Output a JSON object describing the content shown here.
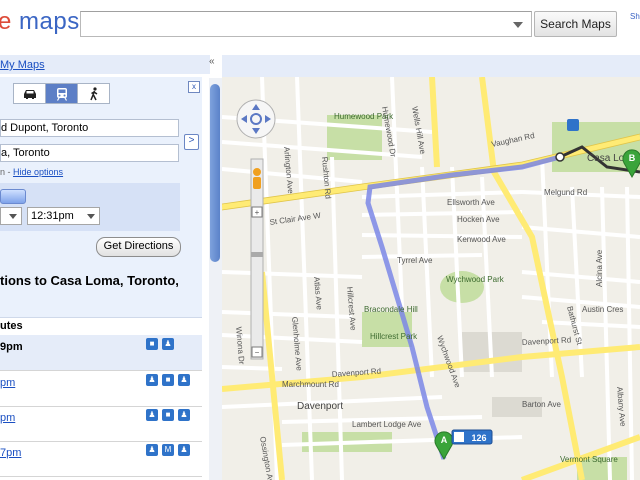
{
  "header": {
    "logo_partial": "e",
    "logo_maps": "maps",
    "search_button": "Search Maps",
    "top_link": "Sh"
  },
  "panel": {
    "my_maps": "My Maps",
    "collapse_glyph": "«",
    "modes": [
      {
        "name": "driving",
        "icon": "car-icon"
      },
      {
        "name": "transit",
        "icon": "train-icon",
        "active": true
      },
      {
        "name": "walking",
        "icon": "walk-icon"
      }
    ],
    "close_glyph": "x",
    "from_value": "d Dupont, Toronto",
    "to_value": "a, Toronto",
    "options_prefix": "n - ",
    "hide_options": "Hide options",
    "time_value": "12:31pm",
    "get_directions": "Get Directions",
    "heading": "tions to Casa Loma, Toronto,",
    "heading_line2": "",
    "routes_label": "utes",
    "routes": [
      {
        "time": "9pm",
        "icons": [
          "bus",
          "walk"
        ]
      },
      {
        "time": "pm",
        "icons": [
          "walk",
          "bus",
          "walk"
        ]
      },
      {
        "time": "pm",
        "icons": [
          "walk",
          "bus",
          "walk"
        ]
      },
      {
        "time": "7pm",
        "icons": [
          "walk",
          "M",
          "walk"
        ]
      }
    ]
  },
  "map": {
    "streets": {
      "st_clair": "St Clair Ave W",
      "davenport": "Davenport Rd",
      "davenport2": "Davenport Rd",
      "marchmount": "Marchmount Rd",
      "ellsworth": "Ellsworth Ave",
      "hocken": "Hocken Ave",
      "kenwood": "Kenwood Ave",
      "tyrrel": "Tyrrel Ave",
      "lambert": "Lambert Lodge Ave",
      "wychwood": "Wychwood Ave",
      "bathurst": "Bathurst St",
      "christie": "Christie St",
      "vaughan": "Vaughan Rd",
      "melgund": "Melgund Rd",
      "austin": "Austin Cres",
      "alcina": "Alcina Ave",
      "burnside": "Burnside Dr",
      "humewood_dr": "Humewood Dr",
      "rushton": "Rushton Rd",
      "arlington": "Arlington Ave",
      "winona": "Winona Dr",
      "atlas": "Atlas Ave",
      "glenholme": "Glenholme Ave",
      "ossington": "Ossington Ave",
      "hillcrest": "Hillcrest Ave",
      "verbena": "Verbena Ave",
      "benson": "Benson Ave",
      "helena": "Helena Ave",
      "ardwold": "Ardwold Gate",
      "wells_hill": "Wells Hill Ave",
      "bartlett": "Bartlett Ave",
      "wychwood_rd": "Wychwood Ave",
      "barton": "Barton Ave",
      "albany": "Albany Ave",
      "lippincott": "Lippincott St"
    },
    "places": {
      "humewood": "Humewood Park",
      "wychwood_park": "Wychwood Park",
      "bracondale": "Bracondale Hill",
      "hillcrest_park": "Hillcrest Park",
      "casa_loma": "Casa Loma",
      "davenport_area": "Davenport",
      "vermont": "Vermont Square"
    },
    "markers": {
      "a": "A",
      "b": "B",
      "bus_route": "126"
    },
    "colors": {
      "route": "#7b87e6",
      "walk_line": "#333333",
      "major_road": "#ffeb74",
      "park": "#c7dfa6"
    }
  }
}
